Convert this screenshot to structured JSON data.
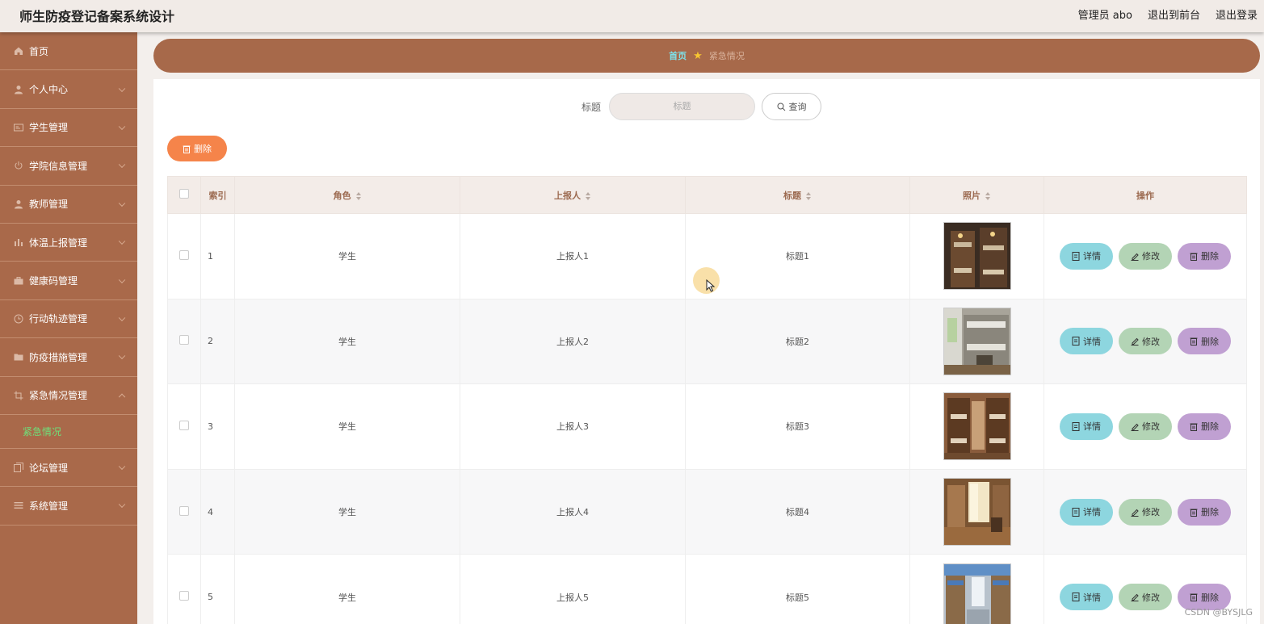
{
  "header": {
    "title": "师生防疫登记备案系统设计",
    "admin_label": "管理员 abo",
    "back_to_front": "退出到前台",
    "logout": "退出登录"
  },
  "sidebar": {
    "items": [
      {
        "label": "首页",
        "icon": "home-icon"
      },
      {
        "label": "个人中心",
        "icon": "user-icon"
      },
      {
        "label": "学生管理",
        "icon": "id-card-icon"
      },
      {
        "label": "学院信息管理",
        "icon": "power-icon"
      },
      {
        "label": "教师管理",
        "icon": "user-icon"
      },
      {
        "label": "体温上报管理",
        "icon": "bar-chart-icon"
      },
      {
        "label": "健康码管理",
        "icon": "briefcase-icon"
      },
      {
        "label": "行动轨迹管理",
        "icon": "clock-icon"
      },
      {
        "label": "防疫措施管理",
        "icon": "folder-icon"
      },
      {
        "label": "紧急情况管理",
        "icon": "crop-icon"
      },
      {
        "label": "论坛管理",
        "icon": "copy-icon"
      },
      {
        "label": "系统管理",
        "icon": "menu-icon"
      }
    ],
    "active_sub": "紧急情况"
  },
  "breadcrumb": {
    "home": "首页",
    "current": "紧急情况"
  },
  "search": {
    "label": "标题",
    "placeholder": "标题",
    "button": "查询"
  },
  "bulk_delete": "删除",
  "table": {
    "headers": {
      "index": "索引",
      "role": "角色",
      "reporter": "上报人",
      "title": "标题",
      "photo": "照片",
      "actions": "操作"
    },
    "rows": [
      {
        "index": "1",
        "role": "学生",
        "reporter": "上报人1",
        "title": "标题1"
      },
      {
        "index": "2",
        "role": "学生",
        "reporter": "上报人2",
        "title": "标题2"
      },
      {
        "index": "3",
        "role": "学生",
        "reporter": "上报人3",
        "title": "标题3"
      },
      {
        "index": "4",
        "role": "学生",
        "reporter": "上报人4",
        "title": "标题4"
      },
      {
        "index": "5",
        "role": "学生",
        "reporter": "上报人5",
        "title": "标题5"
      }
    ],
    "actions": {
      "detail": "详情",
      "edit": "修改",
      "delete": "删除"
    }
  },
  "watermark": "CSDN @BYSJLG",
  "colors": {
    "sidebar": "#a9694a",
    "breadcrumb_bar": "#a7694a",
    "active_sub": "#6fe07a",
    "delete_orange": "#f5844a",
    "detail_button": "#8dd6df",
    "edit_button": "#b3d4b5",
    "delete_button": "#c0a0d2"
  }
}
